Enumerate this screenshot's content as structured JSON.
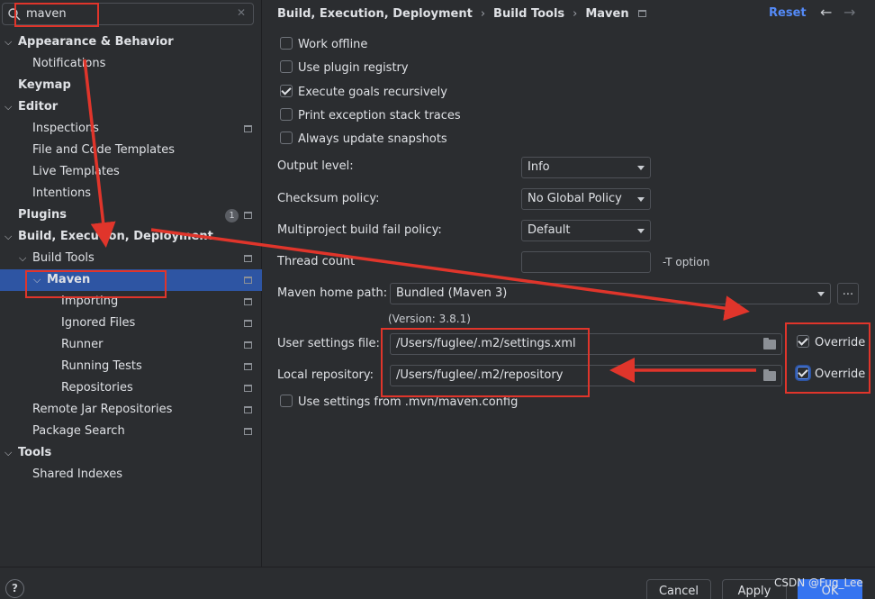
{
  "search": {
    "value": "maven"
  },
  "sidebar": {
    "items": [
      {
        "label": "Appearance & Behavior",
        "bold": true,
        "expanded": true
      },
      {
        "label": "Notifications"
      },
      {
        "label": "Keymap",
        "bold": true
      },
      {
        "label": "Editor",
        "bold": true,
        "expanded": true
      },
      {
        "label": "Inspections",
        "project_icon": true
      },
      {
        "label": "File and Code Templates"
      },
      {
        "label": "Live Templates"
      },
      {
        "label": "Intentions"
      },
      {
        "label": "Plugins",
        "bold": true,
        "badge": "1",
        "project_icon": true
      },
      {
        "label": "Build, Execution, Deployment",
        "bold": true,
        "expanded": true
      },
      {
        "label": "Build Tools",
        "expanded": true,
        "project_icon": true
      },
      {
        "label": "Maven",
        "bold": true,
        "expanded": true,
        "selected": true,
        "project_icon": true
      },
      {
        "label": "Importing",
        "project_icon": true
      },
      {
        "label": "Ignored Files",
        "project_icon": true
      },
      {
        "label": "Runner",
        "project_icon": true
      },
      {
        "label": "Running Tests",
        "project_icon": true
      },
      {
        "label": "Repositories",
        "project_icon": true
      },
      {
        "label": "Remote Jar Repositories",
        "project_icon": true
      },
      {
        "label": "Package Search",
        "project_icon": true
      },
      {
        "label": "Tools",
        "bold": true,
        "expanded": true
      },
      {
        "label": "Shared Indexes"
      }
    ]
  },
  "header": {
    "breadcrumb": [
      "Build, Execution, Deployment",
      "Build Tools",
      "Maven"
    ],
    "reset_label": "Reset"
  },
  "options": {
    "work_offline": {
      "label": "Work offline",
      "checked": false
    },
    "use_plugin_registry": {
      "label": "Use plugin registry",
      "checked": false
    },
    "execute_goals_recursively": {
      "label": "Execute goals recursively",
      "checked": true
    },
    "print_exception_stack_traces": {
      "label": "Print exception stack traces",
      "checked": false
    },
    "always_update_snapshots": {
      "label": "Always update snapshots",
      "checked": false
    },
    "use_mvn_settings": {
      "label": "Use settings from .mvn/maven.config",
      "checked": false
    }
  },
  "fields": {
    "output_level": {
      "label": "Output level:",
      "value": "Info"
    },
    "checksum_policy": {
      "label": "Checksum policy:",
      "value": "No Global Policy"
    },
    "multiproject_fail_policy": {
      "label": "Multiproject build fail policy:",
      "value": "Default"
    },
    "thread_count": {
      "label": "Thread count",
      "value": "",
      "hint": "-T option"
    },
    "maven_home": {
      "label": "Maven home path:",
      "value": "Bundled (Maven 3)",
      "version": "(Version: 3.8.1)",
      "browse": "..."
    },
    "user_settings": {
      "label": "User settings file:",
      "value": "/Users/fuglee/.m2/settings.xml",
      "override_label": "Override",
      "override_checked": true
    },
    "local_repository": {
      "label": "Local repository:",
      "value": "/Users/fuglee/.m2/repository",
      "override_label": "Override",
      "override_checked": true
    }
  },
  "footer": {
    "help": "?",
    "cancel": "Cancel",
    "apply": "Apply",
    "ok": "OK"
  },
  "watermark": "CSDN @Fug_Lee",
  "colors": {
    "background": "#2b2d30",
    "selection": "#2e55a3",
    "accent_link": "#548af7",
    "annotation_red": "#e0352b",
    "primary_button": "#3574f0"
  }
}
